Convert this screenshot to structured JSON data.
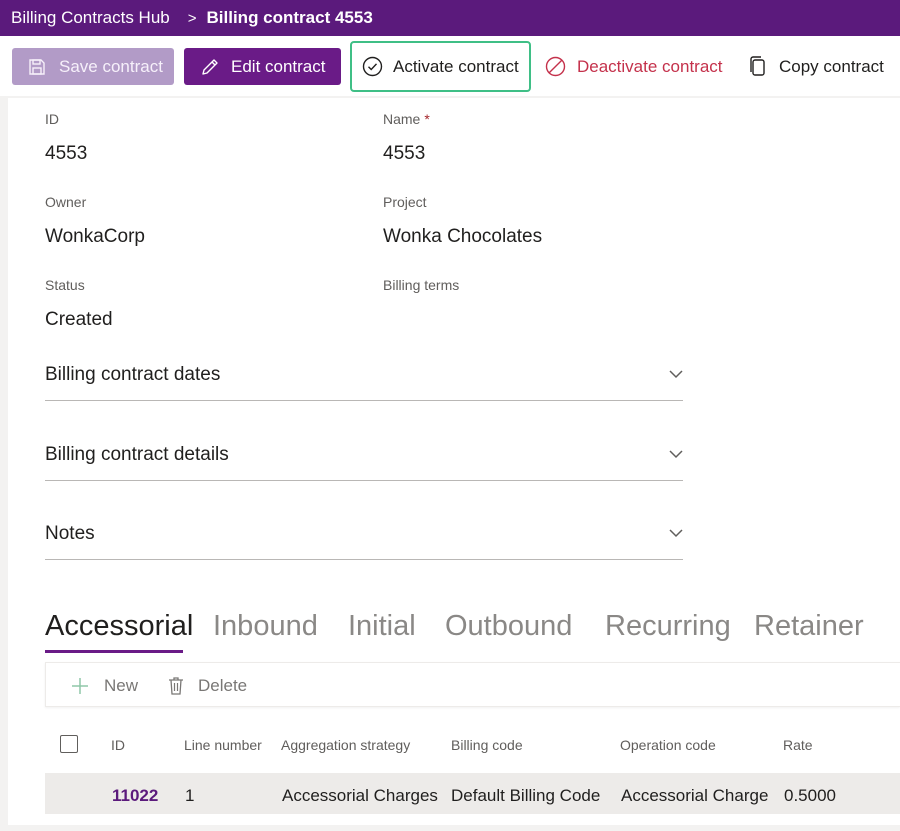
{
  "breadcrumb": {
    "app_name": "Billing Contracts Hub",
    "separator": ">",
    "current": "Billing contract 4553"
  },
  "toolbar": {
    "save_label": "Save contract",
    "edit_label": "Edit contract",
    "activate_label": "Activate contract",
    "deactivate_label": "Deactivate contract",
    "copy_label": "Copy contract",
    "colors": {
      "brand": "#5b1a7c",
      "highlight": "#3fbf86",
      "danger": "#c4314b"
    }
  },
  "form": {
    "id": {
      "label": "ID",
      "value": "4553"
    },
    "name": {
      "label": "Name",
      "required_mark": "*",
      "value": "4553"
    },
    "owner": {
      "label": "Owner",
      "value": "WonkaCorp"
    },
    "project": {
      "label": "Project",
      "value": "Wonka Chocolates"
    },
    "status": {
      "label": "Status",
      "value": "Created"
    },
    "billing_terms": {
      "label": "Billing terms",
      "value": ""
    }
  },
  "sections": [
    {
      "title": "Billing contract dates",
      "icon": "chevron-down-icon"
    },
    {
      "title": "Billing contract details",
      "icon": "chevron-down-icon"
    },
    {
      "title": "Notes",
      "icon": "chevron-down-icon"
    }
  ],
  "tabs": [
    {
      "label": "Accessorial",
      "active": true
    },
    {
      "label": "Inbound"
    },
    {
      "label": "Initial"
    },
    {
      "label": "Outbound"
    },
    {
      "label": "Recurring"
    },
    {
      "label": "Retainer"
    }
  ],
  "grid": {
    "toolbar": {
      "new_label": "New",
      "delete_label": "Delete"
    },
    "columns": [
      "ID",
      "Line number",
      "Aggregation strategy",
      "Billing code",
      "Operation code",
      "Rate"
    ],
    "rows": [
      [
        "11022",
        "1",
        "Accessorial Charges",
        "Default Billing Code",
        "Accessorial Charge",
        "0.5000"
      ]
    ]
  }
}
